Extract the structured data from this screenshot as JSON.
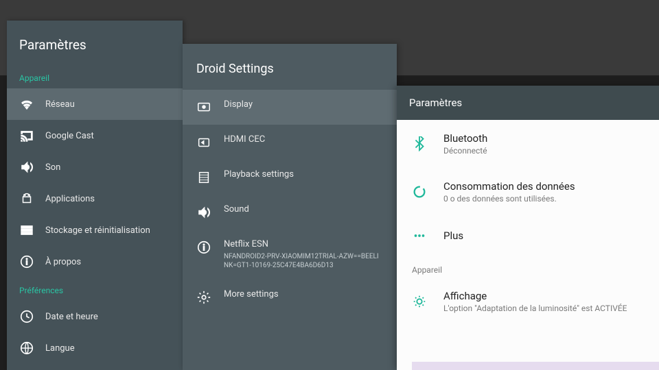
{
  "left": {
    "title": "Paramètres",
    "sections": [
      {
        "header": "Appareil",
        "items": [
          {
            "label": "Réseau",
            "icon": "wifi",
            "selected": true
          },
          {
            "label": "Google Cast",
            "icon": "cast"
          },
          {
            "label": "Son",
            "icon": "volume"
          },
          {
            "label": "Applications",
            "icon": "android"
          },
          {
            "label": "Stockage et réinitialisation",
            "icon": "storage"
          },
          {
            "label": "À propos",
            "icon": "info"
          }
        ]
      },
      {
        "header": "Préférences",
        "items": [
          {
            "label": "Date et heure",
            "icon": "clock"
          },
          {
            "label": "Langue",
            "icon": "globe"
          }
        ]
      }
    ]
  },
  "mid": {
    "title": "Droid Settings",
    "items": [
      {
        "label": "Display",
        "icon": "display",
        "selected": true
      },
      {
        "label": "HDMI CEC",
        "icon": "hdmi"
      },
      {
        "label": "Playback settings",
        "icon": "film"
      },
      {
        "label": "Sound",
        "icon": "volume"
      },
      {
        "label": "Netflix ESN",
        "sub": "NFANDROID2-PRV-XIAOMIM12TRIAL-AZW==BEELINK=GT1-10169-25C47E4BA6D6D13",
        "icon": "info"
      },
      {
        "label": "More settings",
        "icon": "gear"
      }
    ]
  },
  "right": {
    "header": "Paramètres",
    "items": [
      {
        "label": "Bluetooth",
        "sub": "Déconnecté",
        "icon": "bluetooth"
      },
      {
        "label": "Consommation des données",
        "sub": "0 o des données sont utilisées.",
        "icon": "data-ring"
      },
      {
        "label": "Plus",
        "icon": "dots"
      }
    ],
    "section_header": "Appareil",
    "device_item": {
      "label": "Affichage",
      "sub": "L'option \"Adaptation de la luminosité\" est ACTIVÉE",
      "icon": "brightness"
    }
  },
  "colors": {
    "teal": "#1fb89a"
  }
}
